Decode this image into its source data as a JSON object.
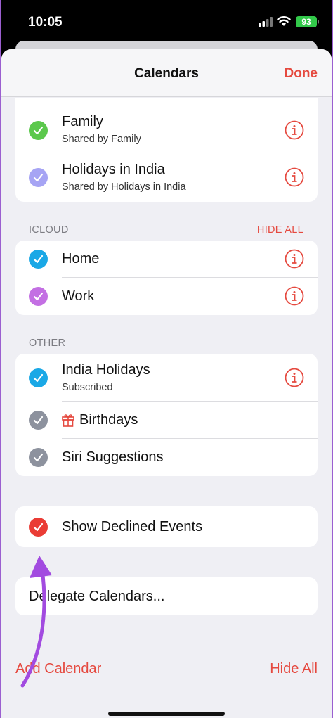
{
  "status_bar": {
    "time": "10:05",
    "battery": "93"
  },
  "nav": {
    "title": "Calendars",
    "done": "Done"
  },
  "top_group": [
    {
      "title": "Family",
      "subtitle": "Shared by Family",
      "color": "#5bc84c"
    },
    {
      "title": "Holidays in India",
      "subtitle": "Shared by Holidays in India",
      "color": "#a6a4f4"
    }
  ],
  "icloud": {
    "label": "ICLOUD",
    "action": "HIDE ALL",
    "items": [
      {
        "title": "Home",
        "color": "#1aa8e6"
      },
      {
        "title": "Work",
        "color": "#c36fe3"
      }
    ]
  },
  "other": {
    "label": "OTHER",
    "items": [
      {
        "title": "India Holidays",
        "subtitle": "Subscribed",
        "color": "#1aa8e6"
      },
      {
        "title": "Birthdays",
        "color": "#8d929e",
        "icon": "gift-icon"
      },
      {
        "title": "Siri Suggestions",
        "color": "#8d929e"
      }
    ]
  },
  "declined": {
    "title": "Show Declined Events",
    "color": "#ea3c35"
  },
  "delegate": {
    "title": "Delegate Calendars..."
  },
  "bottom": {
    "add": "Add Calendar",
    "hide_all": "Hide All"
  },
  "colors": {
    "accent": "#e5493f",
    "annotation_arrow": "#a24be0"
  }
}
